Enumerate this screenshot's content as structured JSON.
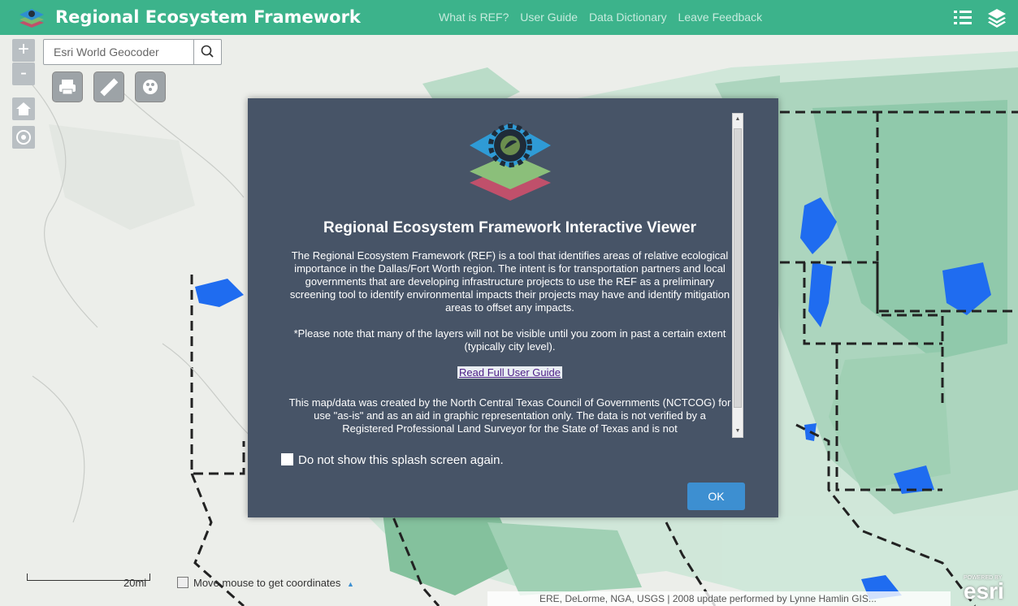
{
  "header": {
    "title": "Regional Ecosystem Framework",
    "nav": [
      "What is REF?",
      "User Guide",
      "Data Dictionary",
      "Leave Feedback"
    ],
    "icons": [
      "layer-list-icon",
      "layers-icon"
    ],
    "color": "#3cb38b"
  },
  "search": {
    "placeholder": "Esri World Geocoder"
  },
  "zoom": {
    "in": "+",
    "out": "-"
  },
  "tools": [
    "print-icon",
    "measure-icon",
    "basemap-gallery-icon"
  ],
  "scalebar": {
    "label": "20mi"
  },
  "coordinates": {
    "text": "Move mouse to get coordinates",
    "arrow": "▲"
  },
  "attribution": {
    "text": "ERE, DeLorme, NGA, USGS | 2008 update performed by Lynne Hamlin GIS..."
  },
  "esri_logo": {
    "powered": "POWERED BY",
    "brand": "esri"
  },
  "modal": {
    "title": "Regional Ecosystem Framework Interactive Viewer",
    "paragraphs": [
      "The Regional Ecosystem Framework (REF) is a tool that identifies areas of relative ecological importance in the Dallas/Fort Worth region. The intent is for transportation partners and local governments that are developing infrastructure projects to use the REF as a preliminary screening tool to identify environmental impacts their projects may have and identify mitigation areas to offset any impacts.",
      "*Please note that many of the layers will not be visible until you zoom in past a certain extent (typically city level).",
      "This map/data was created by the North Central Texas Council of Governments (NCTCOG) for use \"as-is\" and as an aid in graphic representation only. The data is not verified by a Registered Professional Land Surveyor for the State of Texas and is not"
    ],
    "link": "Read Full User Guide",
    "checkbox_label": "Do not show this splash screen again.",
    "ok": "OK",
    "background": "#475467"
  }
}
